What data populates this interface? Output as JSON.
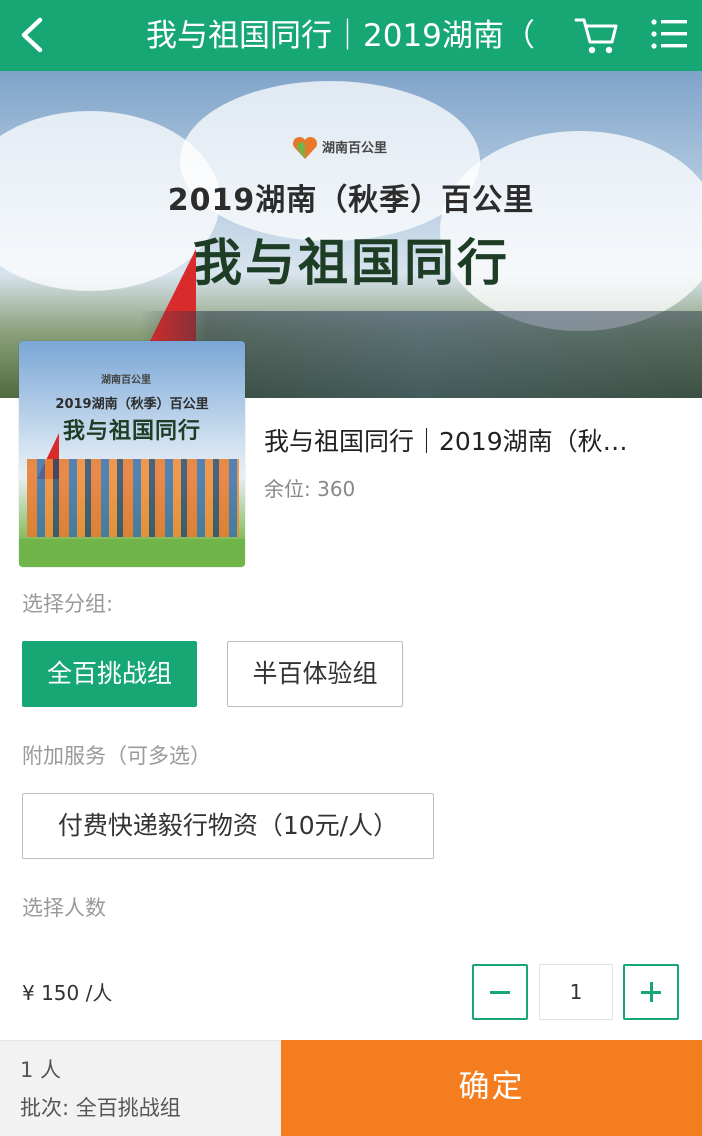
{
  "header": {
    "title": "我与祖国同行｜2019湖南（",
    "back_icon": "chevron-left-icon",
    "cart_icon": "cart-icon",
    "menu_icon": "menu-icon"
  },
  "banner": {
    "brand": "湖南百公里",
    "subtitle": "2019湖南（秋季）百公里",
    "main_title": "我与祖国同行"
  },
  "thumb": {
    "brand": "湖南百公里",
    "subtitle": "2019湖南（秋季）百公里",
    "main_title": "我与祖国同行"
  },
  "product": {
    "title": "我与祖国同行｜2019湖南（秋…",
    "stock": "余位: 360"
  },
  "group": {
    "label": "选择分组:",
    "options": [
      "全百挑战组",
      "半百体验组"
    ],
    "selected": "全百挑战组"
  },
  "services": {
    "label": "附加服务（可多选）",
    "options": [
      "付费快递毅行物资（10元/人）"
    ]
  },
  "people": {
    "label": "选择人数",
    "price": "¥ 150 /人",
    "quantity": "1"
  },
  "footer": {
    "count": "1 人",
    "batch": "批次:  全百挑战组",
    "confirm": "确定"
  },
  "colors": {
    "brand_green": "#16a775",
    "confirm_orange": "#f47d1f"
  }
}
